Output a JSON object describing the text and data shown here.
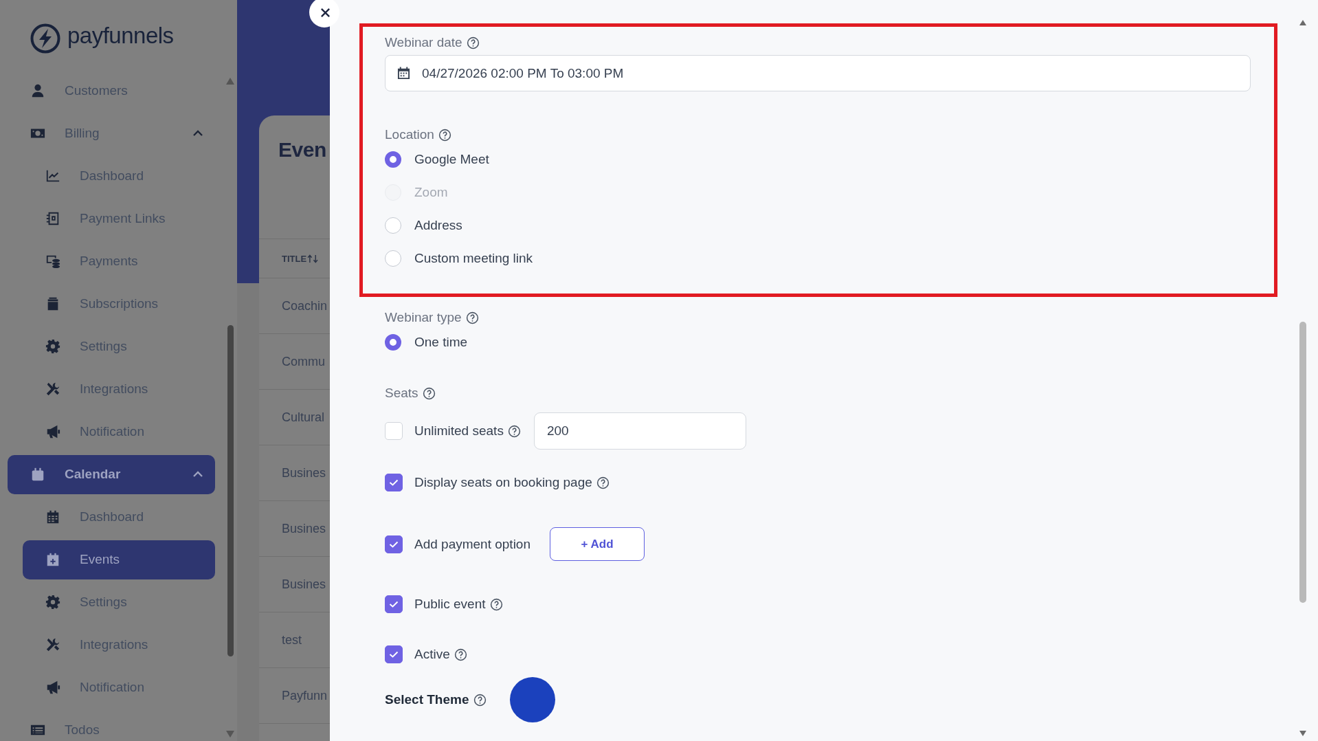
{
  "sidebar": {
    "logo": "payfunnels",
    "items": [
      {
        "label": "Customers",
        "selected": false
      },
      {
        "label": "Billing",
        "selected": false,
        "expanded": true,
        "children": [
          {
            "label": "Dashboard",
            "selected": false
          },
          {
            "label": "Payment Links",
            "selected": false
          },
          {
            "label": "Payments",
            "selected": false
          },
          {
            "label": "Subscriptions",
            "selected": false
          },
          {
            "label": "Settings",
            "selected": false
          },
          {
            "label": "Integrations",
            "selected": false
          },
          {
            "label": "Notification",
            "selected": false
          }
        ]
      },
      {
        "label": "Calendar",
        "selected": true,
        "expanded": true,
        "children": [
          {
            "label": "Dashboard",
            "selected": false
          },
          {
            "label": "Events",
            "selected": true
          },
          {
            "label": "Settings",
            "selected": false
          },
          {
            "label": "Integrations",
            "selected": false
          },
          {
            "label": "Notification",
            "selected": false
          }
        ]
      },
      {
        "label": "Todos",
        "selected": false
      }
    ]
  },
  "events_page": {
    "title": "Even",
    "columns": [
      "TITLE"
    ],
    "rows": [
      "Coachin",
      "Commu",
      "Cultural",
      "Busines",
      "Busines",
      "Busines",
      "test",
      "Payfunn"
    ]
  },
  "form": {
    "highlighted_group": {
      "highlighted": true,
      "date": {
        "label": "Webinar date",
        "value": "04/27/2026 02:00 PM To 03:00 PM"
      },
      "location": {
        "label": "Location",
        "options": [
          {
            "label": "Google Meet",
            "selected": true,
            "disabled": false
          },
          {
            "label": "Zoom",
            "selected": false,
            "disabled": true
          },
          {
            "label": "Address",
            "selected": false,
            "disabled": false
          },
          {
            "label": "Custom meeting link",
            "selected": false,
            "disabled": false
          }
        ]
      }
    },
    "webinar_type": {
      "label": "Webinar type",
      "options": [
        {
          "label": "One time",
          "selected": true
        }
      ]
    },
    "seats": {
      "label": "Seats",
      "unlimited": {
        "label": "Unlimited seats",
        "checked": false
      },
      "value": "200"
    },
    "options": [
      {
        "label": "Display seats on booking page",
        "checked": true,
        "help": true
      },
      {
        "label": "Add payment option",
        "checked": true,
        "help": false,
        "button": "+ Add"
      },
      {
        "label": "Public event",
        "checked": true,
        "help": true
      },
      {
        "label": "Active",
        "checked": true,
        "help": true
      }
    ],
    "theme": {
      "label": "Select Theme",
      "color": "#1b41bd"
    }
  }
}
